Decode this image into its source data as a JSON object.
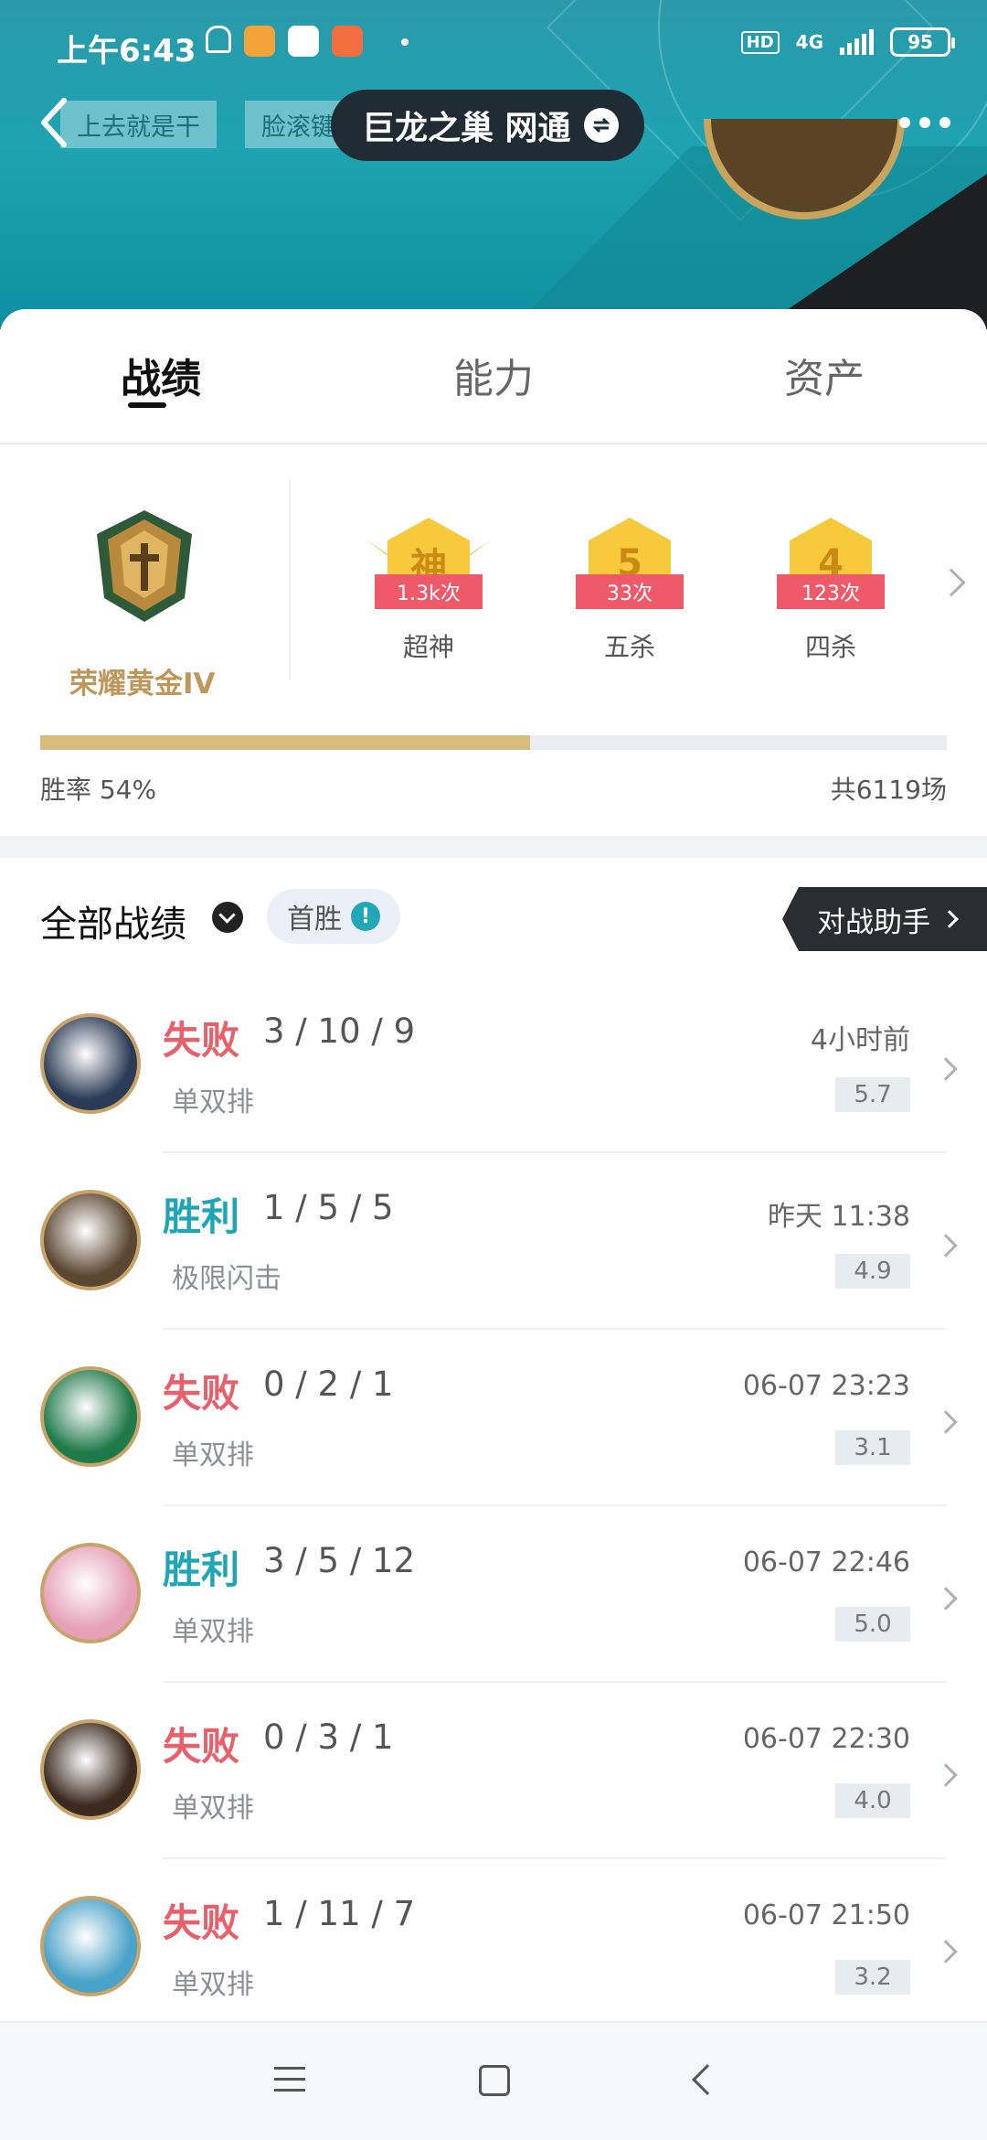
{
  "status_bar": {
    "time": "上午6:43",
    "signal": "4G",
    "hd": "HD",
    "battery": "95"
  },
  "header": {
    "chip1": "上去就是干",
    "chip2": "脸滚键盘",
    "server": "巨龙之巢 网通"
  },
  "tabs": [
    "战绩",
    "能力",
    "资产"
  ],
  "summary": {
    "rank_name": "荣耀黄金IV",
    "achievements": [
      {
        "icon": "神",
        "count": "1.3k次",
        "label": "超神"
      },
      {
        "icon": "5",
        "count": "33次",
        "label": "五杀"
      },
      {
        "icon": "4",
        "count": "123次",
        "label": "四杀"
      }
    ],
    "win_rate_label": "胜率  54%",
    "win_rate": 0.54,
    "total_label": "共6119场"
  },
  "records": {
    "title": "全部战绩",
    "first_win": "首胜",
    "assist_button": "对战助手",
    "matches": [
      {
        "result": "失败",
        "outcome": "lose",
        "kda": "3 / 10 / 9",
        "mode": "单双排",
        "time": "4小时前",
        "score": "5.7",
        "champ_color": "#2b3b55"
      },
      {
        "result": "胜利",
        "outcome": "win",
        "kda": "1 / 5 / 5",
        "mode": "极限闪击",
        "time": "昨天 11:38",
        "score": "4.9",
        "champ_color": "#5b4632"
      },
      {
        "result": "失败",
        "outcome": "lose",
        "kda": "0 / 2 / 1",
        "mode": "单双排",
        "time": "06-07 23:23",
        "score": "3.1",
        "champ_color": "#1f7a4a"
      },
      {
        "result": "胜利",
        "outcome": "win",
        "kda": "3 / 5 / 12",
        "mode": "单双排",
        "time": "06-07 22:46",
        "score": "5.0",
        "champ_color": "#e6a1b8"
      },
      {
        "result": "失败",
        "outcome": "lose",
        "kda": "0 / 3 / 1",
        "mode": "单双排",
        "time": "06-07 22:30",
        "score": "4.0",
        "champ_color": "#3a2a1f"
      },
      {
        "result": "失败",
        "outcome": "lose",
        "kda": "1 / 11 / 7",
        "mode": "单双排",
        "time": "06-07 21:50",
        "score": "3.2",
        "champ_color": "#4aa2c8"
      }
    ]
  }
}
